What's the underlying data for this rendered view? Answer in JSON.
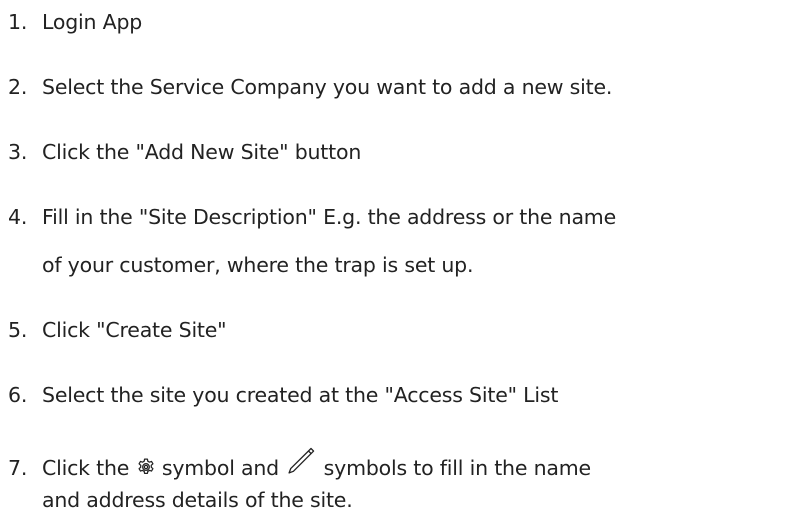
{
  "steps": [
    {
      "number": "1.",
      "text": "Login App"
    },
    {
      "number": "2.",
      "text": "Select the Service Company you want to add a new site."
    },
    {
      "number": "3.",
      "text": "Click the \"Add New Site\" button"
    },
    {
      "number": "4.",
      "text": "Fill in the \"Site Description\" E.g. the address or the name",
      "continuation": "of your customer, where the trap is set up."
    },
    {
      "number": "5.",
      "text": "Click \"Create Site\""
    },
    {
      "number": "6.",
      "text": "Select the site you created at the \"Access Site\" List"
    },
    {
      "number": "7.",
      "text_a": "Click the",
      "text_b": "symbol and",
      "text_c": "symbols to fill in the name",
      "continuation": "and address details of the site.",
      "icons": [
        "gear-icon",
        "pencil-icon"
      ]
    }
  ]
}
